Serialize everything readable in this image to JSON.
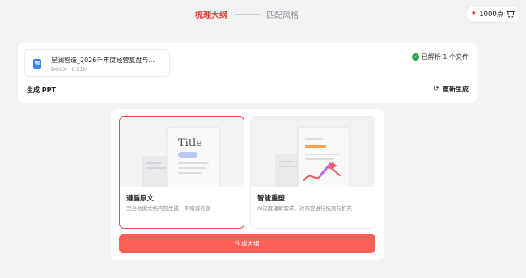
{
  "steps": {
    "active": "梳理大纲",
    "next": "匹配风格"
  },
  "points": {
    "value": "1000点",
    "spark_icon": "sparkle-icon",
    "cart_icon": "cart-icon",
    "accent": "#ef3b36"
  },
  "file": {
    "name": "星澜智造_2026千年度经营复盘与...",
    "meta": "DOCX · 6.51M",
    "type_badge": "W",
    "parsed_status": "已解析 1 个文件",
    "status_color": "#22a34a"
  },
  "ppt": {
    "label": "生成 PPT",
    "regenerate": "重新生成"
  },
  "modes": [
    {
      "title": "遵循原文",
      "description": "完全依据文档内容生成，不增减信息",
      "illus_heading": "Title",
      "selected": true
    },
    {
      "title": "智能重塑",
      "description": "AI深度理解需求，对内容进行拓展与扩充",
      "selected": false
    }
  ],
  "generate_button": "生成大纲",
  "colors": {
    "accent": "#ef4a45",
    "button": "#fb5f55",
    "background": "#f3f3f5"
  }
}
